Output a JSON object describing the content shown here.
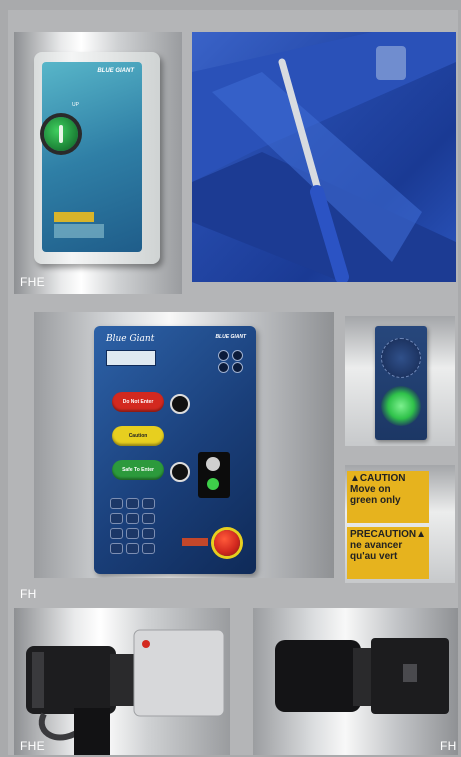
{
  "captions": {
    "top_left": "FHE",
    "middle": "FH",
    "bottom_left": "FHE",
    "bottom_right": "FH"
  },
  "control_box": {
    "brand": "BLUE GIANT",
    "button_label": "UP"
  },
  "panel": {
    "script_logo": "Blue Giant",
    "brand": "BLUE GIANT",
    "btn_red": "Do Not Enter",
    "btn_yellow": "Caution",
    "btn_green": "Safe To Enter"
  },
  "caution_sign": {
    "top": [
      "▲CAUTION",
      "Move on",
      "green only"
    ],
    "bottom": [
      "PRECAUTION▲",
      "ne avancer",
      "qu'au vert"
    ]
  },
  "colors": {
    "blue_panel": "#1d4482",
    "red_light": "#d3291f",
    "yellow_light": "#e7cf1f",
    "green_light": "#2c9a3c",
    "caution_yellow": "#e6b31e"
  }
}
